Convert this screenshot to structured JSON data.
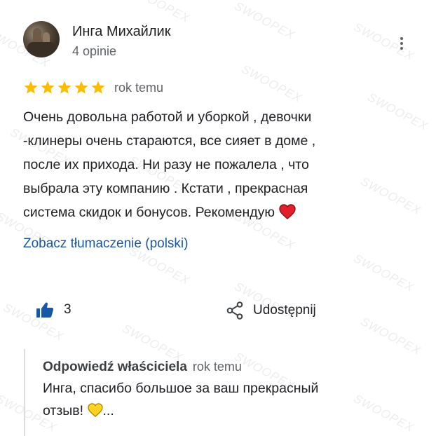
{
  "watermark": {
    "text": "SWOOPEX",
    "color": "#000000"
  },
  "review": {
    "author_name": "Инга Михайлик",
    "author_meta": "4 opinie",
    "rating": 5,
    "rating_max": 5,
    "star_color": "#fbbc04",
    "time": "rok temu",
    "text": "Очень довольна работой и уборкой , девочки\n-клинеры очень стараются, все сияет в доме ,\nпосле их прихода.  Ни разу не пожалела , что\nвыбрала эту компанию . Кстати , прекрасная\nсистема  скидок и бонусов. Рекомендую",
    "text_emoji_icon": "red-heart-icon",
    "translate_link": "Zobacz tłumaczenie (polski)",
    "link_color": "#1a56a8"
  },
  "actions": {
    "like_count": "3",
    "like_icon": "thumbs-up-icon",
    "like_color": "#1a56a8",
    "share_label": "Udostępnij",
    "share_icon": "share-icon"
  },
  "owner_reply": {
    "title": "Odpowiedź właściciela",
    "time": "rok temu",
    "text": "Инга, спасибо большое за ваш прекрасный\nотзыв! ",
    "text_suffix": "...",
    "text_emoji_icon": "yellow-heart-icon"
  }
}
